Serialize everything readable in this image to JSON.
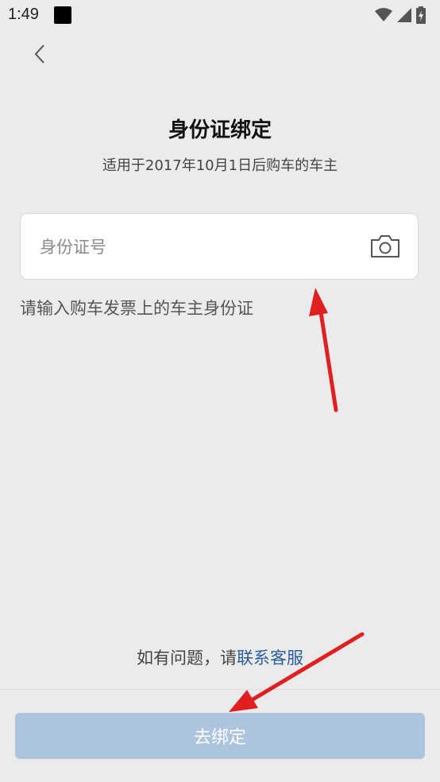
{
  "status_bar": {
    "time": "1:49"
  },
  "icons": {
    "back": "chevron-left-icon",
    "camera": "camera-icon",
    "wifi": "wifi-icon",
    "signal": "signal-icon",
    "battery": "battery-icon"
  },
  "page": {
    "title": "身份证绑定",
    "subtitle": "适用于2017年10月1日后购车的车主"
  },
  "form": {
    "id_placeholder": "身份证号",
    "id_value": "",
    "hint": "请输入购车发票上的车主身份证"
  },
  "help": {
    "prefix": "如有问题，请",
    "link_label": "联系客服"
  },
  "bind_button": {
    "label": "去绑定"
  },
  "colors": {
    "background": "#ebebeb",
    "button_disabled": "#adc4de",
    "link": "#2a5d9c",
    "annotation_arrow": "#e02020"
  }
}
